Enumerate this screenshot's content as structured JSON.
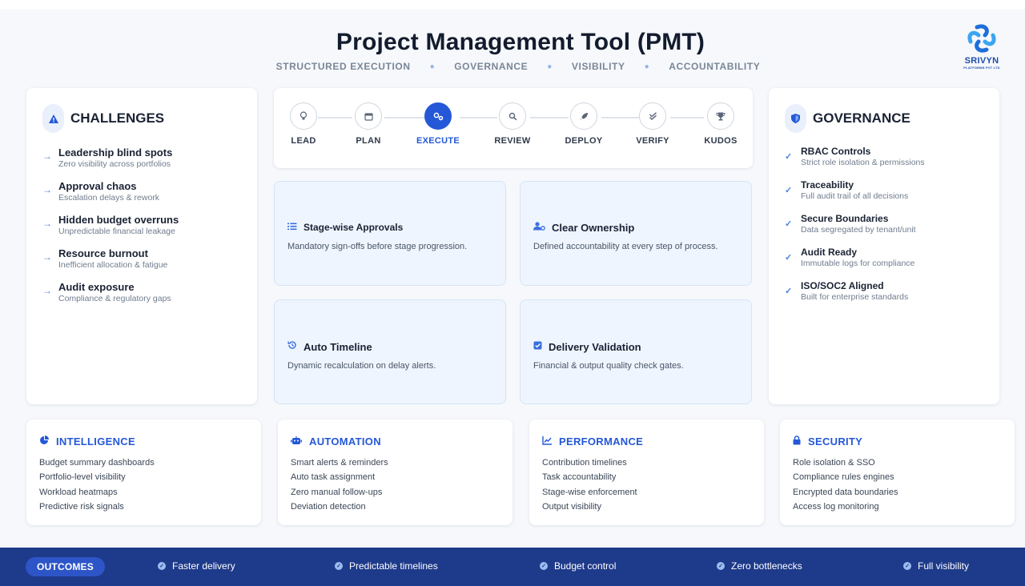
{
  "header": {
    "title": "Project Management Tool (PMT)",
    "pillars": [
      "STRUCTURED  EXECUTION",
      "GOVERNANCE",
      "VISIBILITY",
      "ACCOUNTABILITY"
    ],
    "logo_name": "SRIVYN",
    "logo_sub": "PLATFORMS PVT LTD"
  },
  "challenges": {
    "title": "CHALLENGES",
    "items": [
      {
        "label": "Leadership blind spots",
        "sub": "Zero visibility across portfolios"
      },
      {
        "label": "Approval chaos",
        "sub": "Escalation delays & rework"
      },
      {
        "label": "Hidden budget overruns",
        "sub": "Unpredictable financial leakage"
      },
      {
        "label": "Resource burnout",
        "sub": "Inefficient allocation & fatigue"
      },
      {
        "label": "Audit exposure",
        "sub": "Compliance  &  regulatory gaps"
      }
    ]
  },
  "governance": {
    "title": "GOVERNANCE",
    "items": [
      {
        "label": "RBAC  Controls",
        "sub": "Strict role isolation & permissions"
      },
      {
        "label": "Traceability",
        "sub": "Full audit trail of all decisions"
      },
      {
        "label": "Secure Boundaries",
        "sub": "Data segregated by tenant/unit"
      },
      {
        "label": "Audit Ready",
        "sub": "Immutable  logs  for compliance"
      },
      {
        "label": "ISO/SOC2 Aligned",
        "sub": "Built for enterprise standards"
      }
    ]
  },
  "stepper": {
    "active": "EXECUTE",
    "steps": [
      {
        "label": "LEAD",
        "icon": "bulb-icon"
      },
      {
        "label": "PLAN",
        "icon": "calendar-icon"
      },
      {
        "label": "EXECUTE",
        "icon": "gears-icon"
      },
      {
        "label": "REVIEW",
        "icon": "search-icon"
      },
      {
        "label": "DEPLOY",
        "icon": "rocket-icon"
      },
      {
        "label": "VERIFY",
        "icon": "double-check-icon"
      },
      {
        "label": "KUDOS",
        "icon": "trophy-icon"
      }
    ]
  },
  "features": [
    {
      "title": "Stage-wise Approvals",
      "desc": "Mandatory sign-offs before stage progression.",
      "icon": "list-check-icon"
    },
    {
      "title": "Clear Ownership",
      "desc": "Defined accountability at every step of process.",
      "icon": "user-gear-icon"
    },
    {
      "title": "Auto Timeline",
      "desc": "Dynamic recalculation on delay alerts.",
      "icon": "history-icon"
    },
    {
      "title": "Delivery Validation",
      "desc": "Financial & output quality check gates.",
      "icon": "check-square-icon"
    }
  ],
  "capabilities": [
    {
      "title": "INTELLIGENCE",
      "icon": "pie-chart-icon",
      "items": [
        "Budget summary dashboards",
        "Portfolio-level visibility",
        "Workload heatmaps",
        "Predictive risk signals"
      ]
    },
    {
      "title": "AUTOMATION",
      "icon": "robot-icon",
      "items": [
        "Smart alerts & reminders",
        "Auto task assignment",
        "Zero manual  follow-ups",
        "Deviation  detection"
      ]
    },
    {
      "title": "PERFORMANCE",
      "icon": "line-chart-icon",
      "items": [
        "Contribution timelines",
        "Task accountability",
        "Stage-wise enforcement",
        "Output visibility"
      ]
    },
    {
      "title": "SECURITY",
      "icon": "lock-icon",
      "items": [
        "Role isolation & SSO",
        "Compliance rules engines",
        "Encrypted data boundaries",
        "Access log monitoring"
      ]
    }
  ],
  "outcomes": {
    "label": "OUTCOMES",
    "items": [
      "Faster delivery",
      "Predictable timelines",
      "Budget control",
      "Zero bottlenecks",
      "Full visibility"
    ]
  },
  "colors": {
    "accent": "#2458d8",
    "footer": "#1e3a8a",
    "tile_bg": "#eef5fe"
  }
}
